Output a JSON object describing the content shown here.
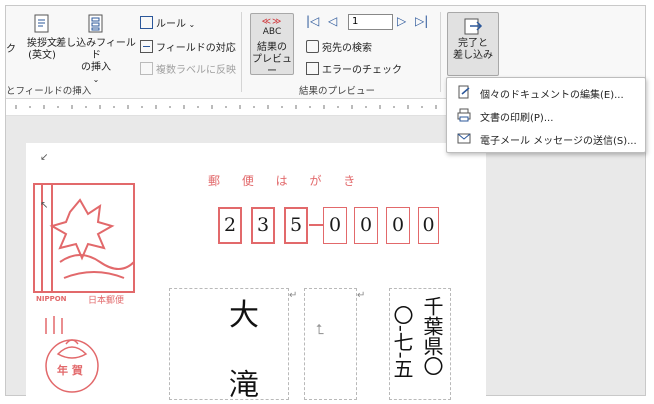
{
  "ribbon": {
    "greeting_btn": "挨拶文\n(英文)",
    "insert_field_btn": "差し込みフィールド\nの挿入",
    "rules": "ルール",
    "match_fields": "フィールドの対応",
    "update_labels": "複数ラベルに反映",
    "group_left_label": "とフィールドの挿入",
    "abc_icon": "ABC",
    "abc_marks": "≪≫",
    "preview_btn": "結果の\nプレビュー",
    "record_number": "1",
    "find_recipient": "宛先の検索",
    "check_errors": "エラーのチェック",
    "group_preview_label": "結果のプレビュー",
    "finish_merge_btn": "完了と\n差し込み",
    "left_clip": "ク"
  },
  "menu": {
    "items": [
      {
        "label": "個々のドキュメントの編集(E)..."
      },
      {
        "label": "文書の印刷(P)..."
      },
      {
        "label": "電子メール メッセージの送信(S)..."
      }
    ]
  },
  "postcard": {
    "header": "郵 便 は が き",
    "postal_digits": [
      "2",
      "3",
      "5",
      "0",
      "0",
      "0",
      "0"
    ],
    "brand_text": "NIPPON",
    "brand_jp": "日本郵便",
    "nenga_text": "年 賀",
    "name_char_1": "大",
    "name_char_2": "滝",
    "address_line_1": "千葉県〇",
    "address_line_2": "〇-七-五"
  },
  "colors": {
    "stamp_red": "#e2696b",
    "accent_blue": "#2b579a"
  }
}
